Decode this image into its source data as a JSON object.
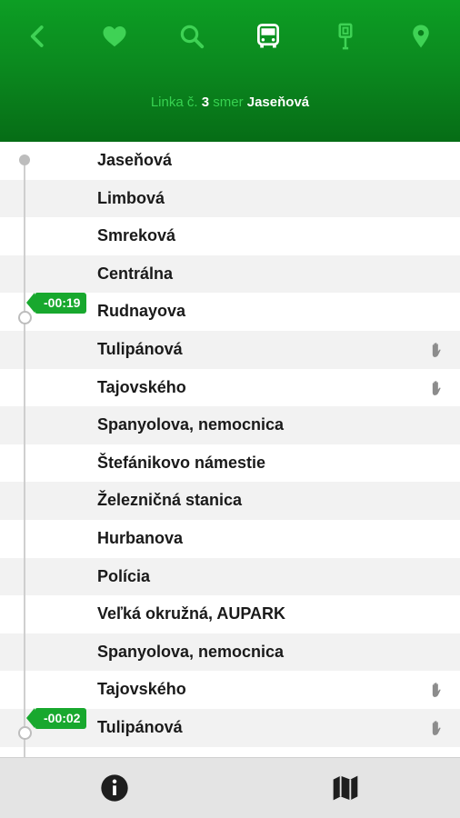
{
  "toolbar": {
    "icons": [
      "back-icon",
      "favorite-heart-icon",
      "search-icon",
      "bus-icon",
      "bus-stop-icon",
      "location-pin-icon"
    ],
    "accent_color": "#3fd255",
    "active_color": "#ffffff"
  },
  "line_info": {
    "prefix": "Linka č.",
    "number": "3",
    "middle": "smer",
    "destination": "Jaseňová"
  },
  "stops": [
    {
      "name": "Jaseňová",
      "on_request": false
    },
    {
      "name": "Limbová",
      "on_request": false
    },
    {
      "name": "Smreková",
      "on_request": false
    },
    {
      "name": "Centrálna",
      "on_request": false
    },
    {
      "name": "Rudnayova",
      "on_request": false
    },
    {
      "name": "Tulipánová",
      "on_request": true
    },
    {
      "name": "Tajovského",
      "on_request": true
    },
    {
      "name": "Spanyolova, nemocnica",
      "on_request": false
    },
    {
      "name": "Štefánikovo námestie",
      "on_request": false
    },
    {
      "name": "Železničná stanica",
      "on_request": false
    },
    {
      "name": "Hurbanova",
      "on_request": false
    },
    {
      "name": "Polícia",
      "on_request": false
    },
    {
      "name": "Veľká okružná, AUPARK",
      "on_request": false
    },
    {
      "name": "Spanyolova, nemocnica",
      "on_request": false
    },
    {
      "name": "Tajovského",
      "on_request": true
    },
    {
      "name": "Tulipánová",
      "on_request": true
    },
    {
      "name": "",
      "on_request": false
    }
  ],
  "vehicles": [
    {
      "delay": "-00:19",
      "stop_index": 4
    },
    {
      "delay": "-00:02",
      "stop_index": 15
    }
  ],
  "bottom_bar": {
    "icons": [
      "info-icon",
      "map-icon"
    ]
  }
}
